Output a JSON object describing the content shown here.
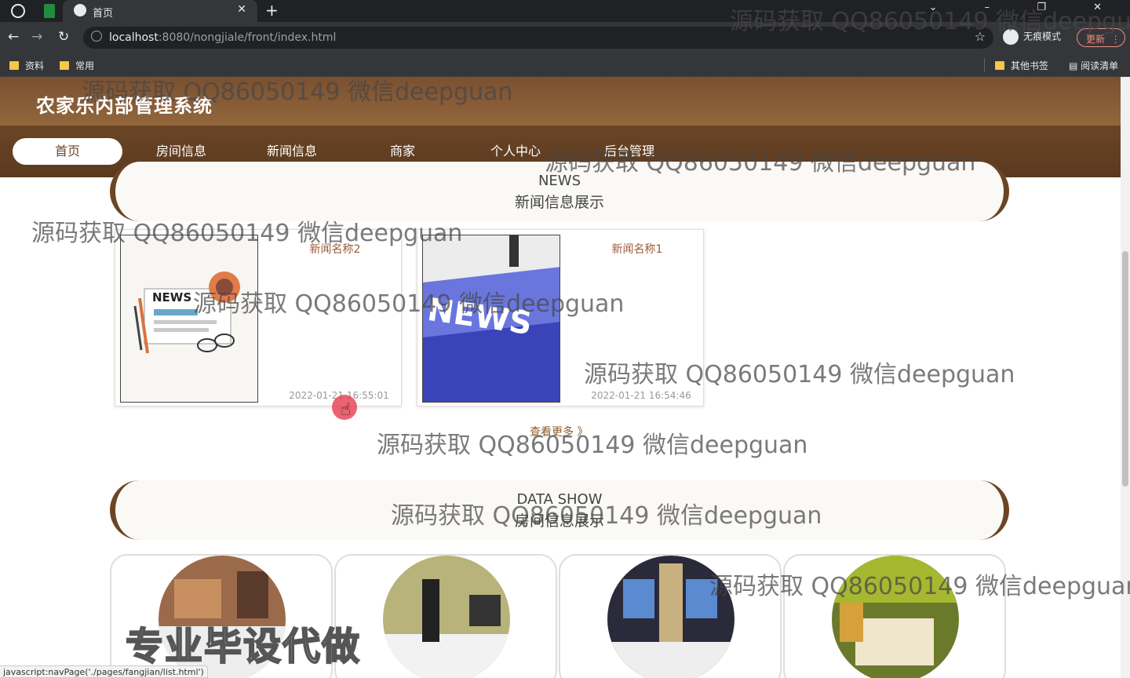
{
  "browser": {
    "tab_title": "首页",
    "url_host": "localhost",
    "url_rest": ":8080/nongjiale/front/index.html",
    "incognito_label": "无痕模式",
    "update_label": "更新",
    "bookmarks": [
      "资料",
      "常用"
    ],
    "other_bookmarks": "其他书签",
    "reading_list": "阅读清单"
  },
  "site": {
    "title": "农家乐内部管理系统",
    "nav": [
      "首页",
      "房间信息",
      "新闻信息",
      "商家",
      "个人中心",
      "后台管理"
    ]
  },
  "news_section": {
    "en": "NEWS",
    "zh": "新闻信息展示",
    "items": [
      {
        "name": "新闻名称2",
        "date": "2022-01-21 16:55:01",
        "icon": "newspaper-illustration"
      },
      {
        "name": "新闻名称1",
        "date": "2022-01-21 16:54:46",
        "icon": "news-keyboard-key"
      }
    ],
    "more": "查看更多 》"
  },
  "room_section": {
    "en": "DATA SHOW",
    "zh": "房间信息展示"
  },
  "status_url": "javascript:navPage('./pages/fangjian/list.html')",
  "overlay_text": "专业毕设代做",
  "watermark": "源码获取 QQ86050149 微信deepguan",
  "colors": {
    "brand": "#6b4526",
    "accent": "#9b5a3a"
  }
}
